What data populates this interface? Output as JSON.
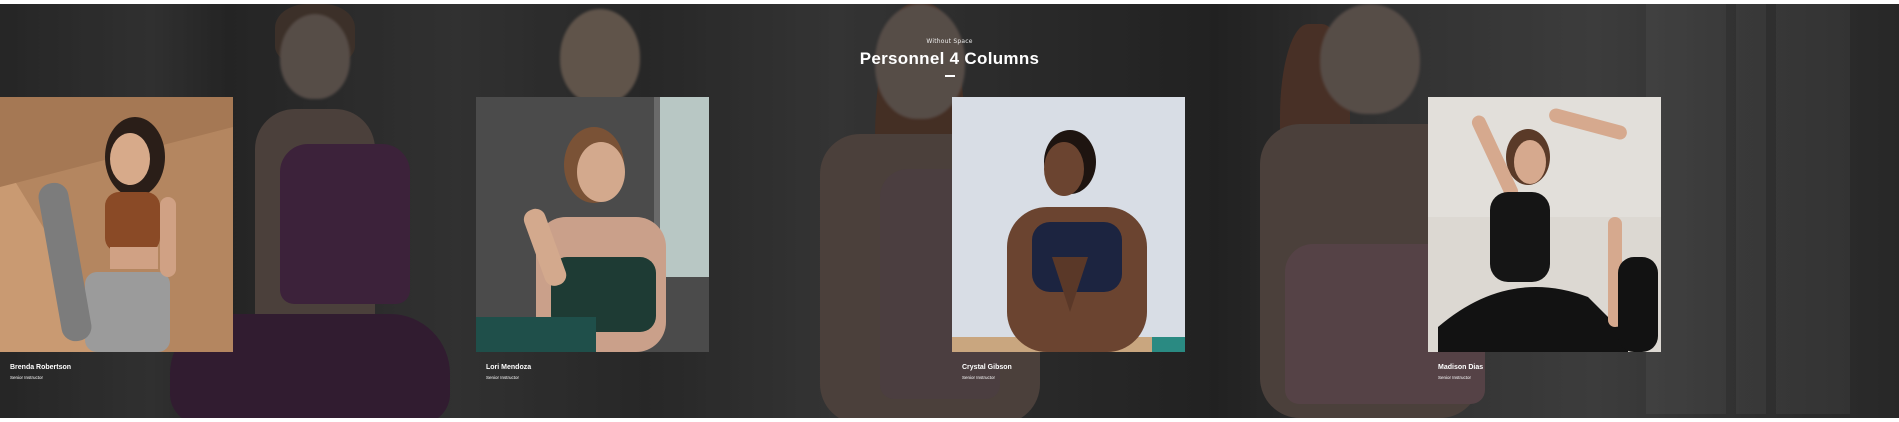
{
  "section": {
    "eyebrow": "Without Space",
    "title": "Personnel 4 Columns"
  },
  "personnel": [
    {
      "name": "Brenda Robertson",
      "role": "Senior Instructor"
    },
    {
      "name": "Lori Mendoza",
      "role": "Senior Instructor"
    },
    {
      "name": "Crystal Gibson",
      "role": "Senior Instructor"
    },
    {
      "name": "Madison Dias",
      "role": "Senior Instructor"
    }
  ],
  "colors": {
    "text": "#ffffff",
    "overlay": "#2a2a2a"
  }
}
